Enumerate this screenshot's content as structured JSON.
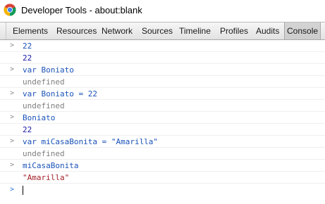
{
  "window": {
    "title": "Developer Tools - about:blank",
    "icon": "chrome-icon"
  },
  "tabs": [
    {
      "label": "Elements"
    },
    {
      "label": "Resources"
    },
    {
      "label": "Network"
    },
    {
      "label": "Sources"
    },
    {
      "label": "Timeline"
    },
    {
      "label": "Profiles"
    },
    {
      "label": "Audits"
    },
    {
      "label": "Console",
      "selected": true
    }
  ],
  "console": {
    "entries": [
      {
        "kind": "input",
        "text": "22"
      },
      {
        "kind": "result",
        "text": "22"
      },
      {
        "kind": "input",
        "text": "var Boniato"
      },
      {
        "kind": "result",
        "text": "undefined"
      },
      {
        "kind": "input",
        "text": "var Boniato = 22"
      },
      {
        "kind": "result",
        "text": "undefined"
      },
      {
        "kind": "input",
        "text": "Boniato"
      },
      {
        "kind": "result",
        "text": "22"
      },
      {
        "kind": "input",
        "text": "var miCasaBonita = \"Amarilla\""
      },
      {
        "kind": "result",
        "text": "undefined"
      },
      {
        "kind": "input",
        "text": "miCasaBonita"
      },
      {
        "kind": "result",
        "text": "\"Amarilla\""
      }
    ],
    "prompt_symbol": ">",
    "current_input": ""
  },
  "colors": {
    "input_text": "#1a52b8",
    "number_result": "#1a1aa6",
    "undefined_result": "#808080",
    "string_result": "#a5232a",
    "active_prompt": "#2d73d6"
  }
}
